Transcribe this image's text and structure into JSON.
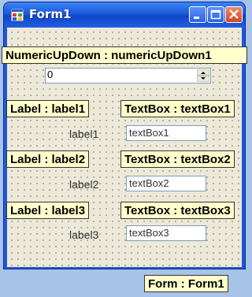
{
  "window": {
    "title": "Form1",
    "icon": "form-icon",
    "buttons": [
      "minimize-icon",
      "maximize-icon",
      "close-icon"
    ]
  },
  "tags": {
    "numeric": "NumericUpDown : numericUpDown1",
    "label1": "Label : label1",
    "textbox1": "TextBox : textBox1",
    "label2": "Label : label2",
    "textbox2": "TextBox : textBox2",
    "label3": "Label : label3",
    "textbox3": "TextBox : textBox3",
    "form": "Form : Form1"
  },
  "numeric_updown": {
    "value": "0"
  },
  "labels": [
    "label1",
    "label2",
    "label3"
  ],
  "textboxes": [
    "textBox1",
    "textBox2",
    "textBox3"
  ]
}
